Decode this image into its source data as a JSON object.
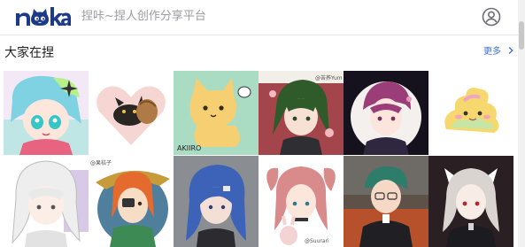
{
  "header": {
    "logo_text": "noka",
    "tagline": "捏咔~捏人创作分享平台",
    "avatar_icon": "user-circle-icon"
  },
  "section": {
    "title": "大家在捏",
    "more_label": "更多"
  },
  "gallery": {
    "watermarks": {
      "tile3": "AKIIRO",
      "tile4": "@苦荞Yum",
      "tile8": "@果桔子",
      "tile10": "@Suurari"
    }
  },
  "colors": {
    "brand": "#1d3a8a",
    "link": "#3d6fd8"
  }
}
